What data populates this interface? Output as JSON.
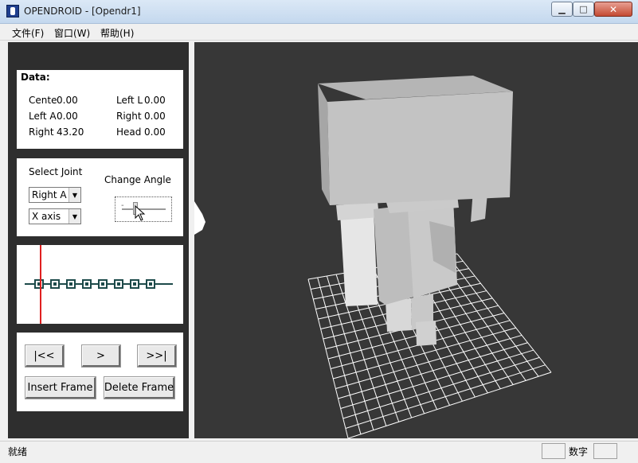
{
  "window": {
    "title": "OPENDROID - [Opendr1]",
    "minimize_glyph": "▁",
    "maximize_glyph": "□",
    "close_glyph": "✕"
  },
  "menu": {
    "items": [
      {
        "label": "文件(F)"
      },
      {
        "label": "窗口(W)"
      },
      {
        "label": "帮助(H)"
      }
    ]
  },
  "data_panel": {
    "heading": "Data:",
    "fields": [
      {
        "label": "Cente",
        "value": "0.00"
      },
      {
        "label": "Left L",
        "value": "0.00"
      },
      {
        "label": "Left A",
        "value": "0.00"
      },
      {
        "label": "Right",
        "value": "0.00"
      },
      {
        "label": "Right",
        "value": "43.20"
      },
      {
        "label": "Head",
        "value": "0.00"
      }
    ]
  },
  "joint_panel": {
    "select_joint_label": "Select Joint",
    "change_angle_label": "Change Angle",
    "joint_selected": "Right A",
    "axis_selected": "X axis",
    "slider_minus": "-",
    "dropdown_glyph": "▼"
  },
  "timeline": {
    "keyframe_count": 8,
    "playhead_frame": 1
  },
  "controls": {
    "first_label": "|<<",
    "next_label": ">",
    "last_label": ">>|",
    "insert_label": "Insert Frame",
    "delete_label": "Delete Frame"
  },
  "statusbar": {
    "text": "就绪",
    "num_label": "数字"
  },
  "colors": {
    "panel_bg": "#2e2e2e",
    "viewport_bg": "#373737",
    "playhead": "#e02020",
    "timeline": "#1d4a4a"
  }
}
